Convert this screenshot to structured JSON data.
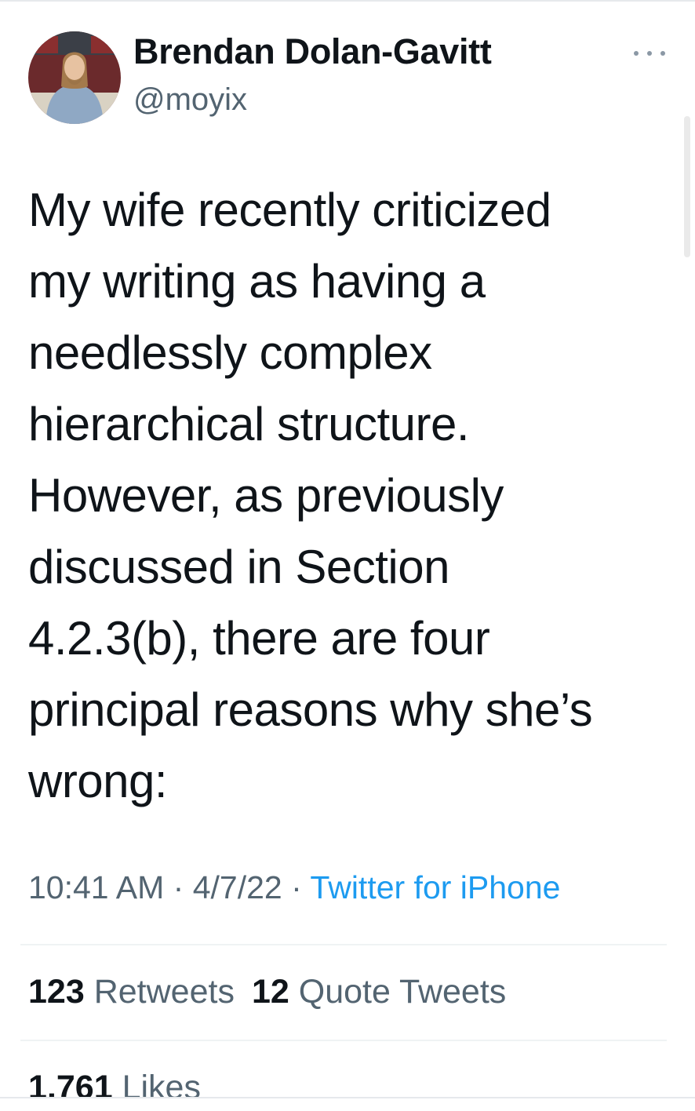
{
  "author": {
    "display_name": "Brendan Dolan-Gavitt",
    "handle": "@moyix"
  },
  "tweet": {
    "text": "My wife recently criticized\nmy writing as having a\nneedlessly complex\nhierarchical structure.\nHowever, as previously\ndiscussed in Section\n4.2.3(b), there are four\nprincipal reasons why she’s\nwrong:",
    "time": "10:41 AM",
    "date": "4/7/22",
    "separator": "·",
    "source": "Twitter for iPhone"
  },
  "stats": {
    "retweets_count": "123",
    "retweets_label": "Retweets",
    "quotes_count": "12",
    "quotes_label": "Quote Tweets",
    "likes_count": "1,761",
    "likes_label": "Likes"
  },
  "icons": {
    "more": "more-icon",
    "avatar": "avatar"
  },
  "colors": {
    "text": "#0f1419",
    "secondary": "#536471",
    "link": "#1d9bf0",
    "divider": "#eff3f4"
  }
}
